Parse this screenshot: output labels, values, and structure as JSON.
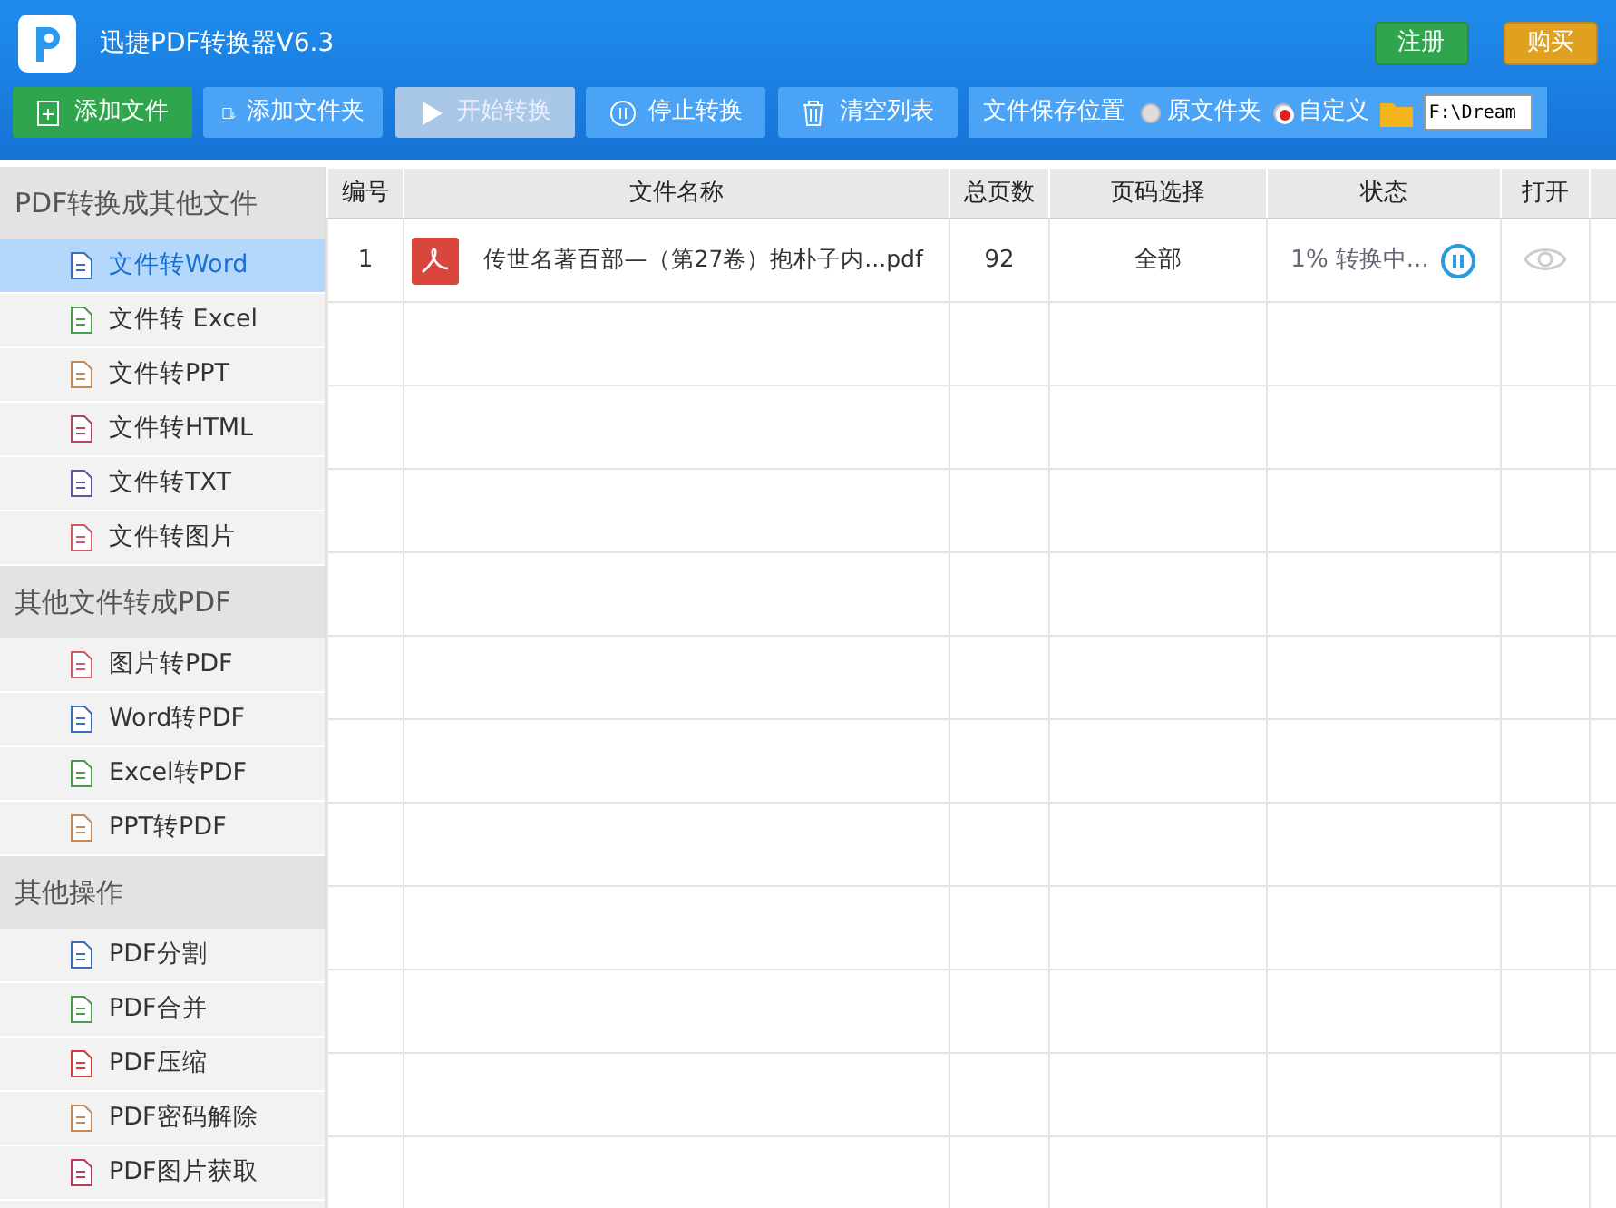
{
  "window": {
    "title": "迅捷PDF转换器V6.3"
  },
  "header_buttons": [
    {
      "label": "注册",
      "kind": "register"
    },
    {
      "label": "购买",
      "kind": "buy"
    }
  ],
  "toolbar": [
    {
      "label": "添加文件",
      "kind": "add-file",
      "disabled": false
    },
    {
      "label": "添加文件夹",
      "kind": "add-folder",
      "disabled": false
    },
    {
      "label": "开始转换",
      "kind": "start",
      "disabled": true
    },
    {
      "label": "停止转换",
      "kind": "stop",
      "disabled": false
    },
    {
      "label": "清空列表",
      "kind": "clear",
      "disabled": false
    }
  ],
  "save_location": {
    "label": "文件保存位置",
    "options": [
      {
        "label": "原文件夹",
        "selected": false
      },
      {
        "label": "自定义",
        "selected": true
      }
    ],
    "path": "F:\\Dream"
  },
  "sidebar": [
    {
      "title": "PDF转换成其他文件",
      "items": [
        {
          "label": "文件转Word",
          "color": "#3b6cc0",
          "selected": true
        },
        {
          "label": "文件转 Excel",
          "color": "#4a9c4a",
          "selected": false
        },
        {
          "label": "文件转PPT",
          "color": "#c08a5a",
          "selected": false
        },
        {
          "label": "文件转HTML",
          "color": "#b04a5a",
          "selected": false
        },
        {
          "label": "文件转TXT",
          "color": "#5a5aa0",
          "selected": false
        },
        {
          "label": "文件转图片",
          "color": "#d05a6a",
          "selected": false
        }
      ]
    },
    {
      "title": "其他文件转成PDF",
      "items": [
        {
          "label": "图片转PDF",
          "color": "#d05a6a",
          "selected": false
        },
        {
          "label": "Word转PDF",
          "color": "#3b6cc0",
          "selected": false
        },
        {
          "label": "Excel转PDF",
          "color": "#4a9c4a",
          "selected": false
        },
        {
          "label": "PPT转PDF",
          "color": "#c08a5a",
          "selected": false
        }
      ]
    },
    {
      "title": "其他操作",
      "items": [
        {
          "label": "PDF分割",
          "color": "#3b6cc0",
          "selected": false
        },
        {
          "label": "PDF合并",
          "color": "#4a9c4a",
          "selected": false
        },
        {
          "label": "PDF压缩",
          "color": "#d04040",
          "selected": false
        },
        {
          "label": "PDF密码解除",
          "color": "#c08a5a",
          "selected": false
        },
        {
          "label": "PDF图片获取",
          "color": "#c03a5a",
          "selected": false
        }
      ]
    }
  ],
  "table": {
    "columns": [
      "编号",
      "文件名称",
      "总页数",
      "页码选择",
      "状态",
      "打开",
      ""
    ],
    "rows": [
      {
        "number": "1",
        "file_name": "传世名著百部—（第27卷）抱朴子内...pdf",
        "pages": "92",
        "page_range": "全部",
        "status": "1% 转换中..."
      }
    ]
  }
}
